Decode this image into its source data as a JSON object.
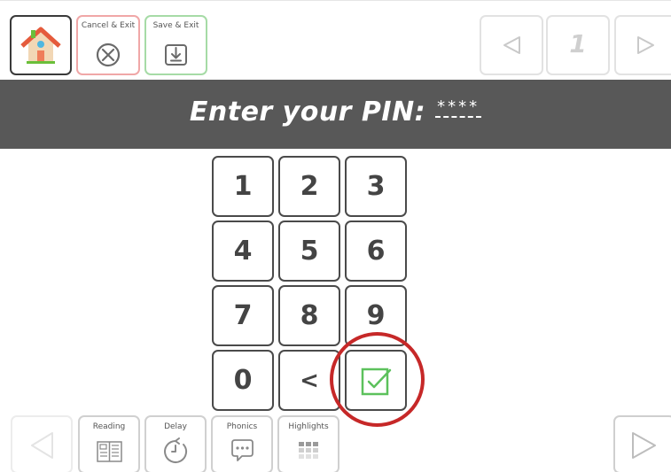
{
  "toolbar": {
    "cancel_label": "Cancel & Exit",
    "save_label": "Save & Exit",
    "page_number": "1",
    "home_icon": "home-icon",
    "cancel_icon": "circle-x-icon",
    "save_icon": "download-icon",
    "cancel_color": "#f0a7a7",
    "save_color": "#a6dba6"
  },
  "header": {
    "title": "Enter your PIN:",
    "pin_value": "****",
    "background": "#585858"
  },
  "keypad": {
    "keys": [
      "1",
      "2",
      "3",
      "4",
      "5",
      "6",
      "7",
      "8",
      "9",
      "0",
      "<"
    ],
    "confirm_icon": "checkbox-check-icon",
    "confirm_color": "#5cc15c",
    "highlight_color": "#c62828"
  },
  "bottom_toolbar": {
    "items": [
      {
        "label": "Reading",
        "icon": "reading-icon"
      },
      {
        "label": "Delay",
        "icon": "timer-icon"
      },
      {
        "label": "Phonics",
        "icon": "speech-bubble-icon"
      },
      {
        "label": "Highlights",
        "icon": "grid-icon"
      }
    ]
  }
}
